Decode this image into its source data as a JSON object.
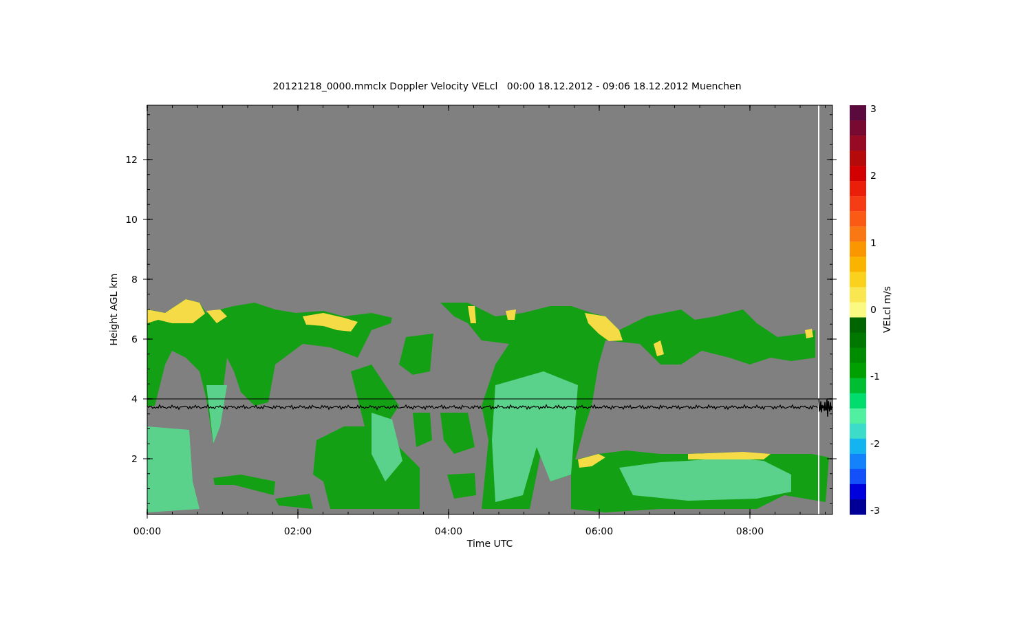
{
  "title": "20121218_0000.mmclx Doppler Velocity VELcl   00:00 18.12.2012 - 09:06 18.12.2012 Muenchen",
  "x_axis": {
    "label": "Time UTC",
    "ticks": [
      "00:00",
      "02:00",
      "04:00",
      "06:00",
      "08:00"
    ]
  },
  "y_axis": {
    "label": "Height AGL km",
    "ticks": [
      "12",
      "10",
      "8",
      "6",
      "4",
      "2"
    ]
  },
  "colorbar": {
    "label": "VELcl m/s",
    "ticks": [
      "3",
      "2",
      "1",
      "0",
      "-1",
      "-2",
      "-3"
    ],
    "segments": [
      {
        "color": "#5a0a3c"
      },
      {
        "color": "#780a32"
      },
      {
        "color": "#960a23"
      },
      {
        "color": "#b40a0a"
      },
      {
        "color": "#d20000"
      },
      {
        "color": "#eb1e0a"
      },
      {
        "color": "#f53c14"
      },
      {
        "color": "#fa5a14"
      },
      {
        "color": "#fa7814"
      },
      {
        "color": "#fa9600"
      },
      {
        "color": "#fab400"
      },
      {
        "color": "#fad21e"
      },
      {
        "color": "#fae650"
      },
      {
        "color": "#fafa82"
      },
      {
        "color": "#006400"
      },
      {
        "color": "#007800"
      },
      {
        "color": "#008c00"
      },
      {
        "color": "#00a000"
      },
      {
        "color": "#00be32"
      },
      {
        "color": "#00dc6e"
      },
      {
        "color": "#50f0a0"
      },
      {
        "color": "#3cdcc8"
      },
      {
        "color": "#14b4f0"
      },
      {
        "color": "#1482fa"
      },
      {
        "color": "#1450fa"
      },
      {
        "color": "#0000dc"
      },
      {
        "color": "#000096"
      }
    ]
  }
}
